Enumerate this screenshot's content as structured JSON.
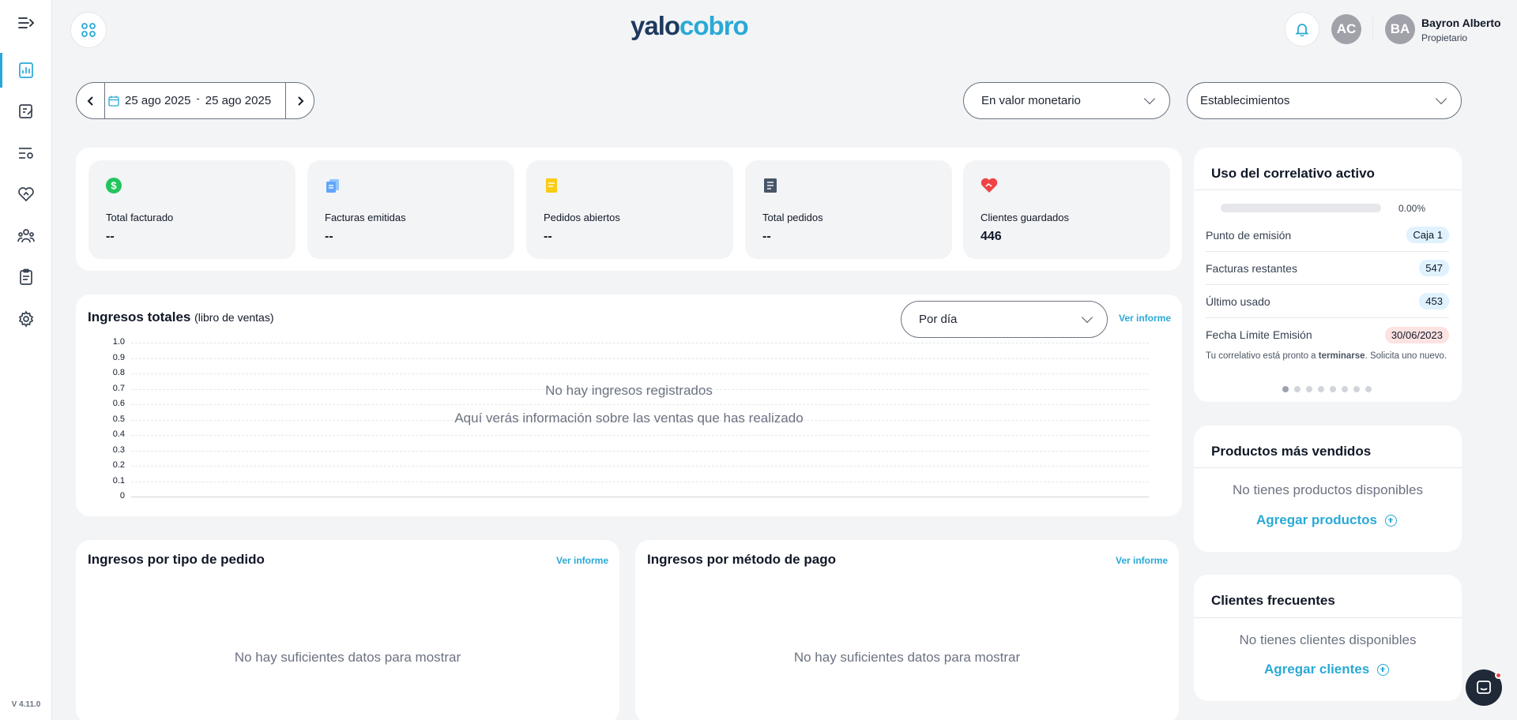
{
  "app": {
    "logo_part1": "yalo",
    "logo_part2": "cobro",
    "version": "V 4.11.0"
  },
  "sidebar": {
    "items": [
      {
        "name": "dashboard",
        "active": true
      },
      {
        "name": "invoices"
      },
      {
        "name": "filters-settings"
      },
      {
        "name": "clients"
      },
      {
        "name": "team"
      },
      {
        "name": "orders"
      },
      {
        "name": "settings"
      }
    ]
  },
  "header": {
    "avatar_small": "AC",
    "user_avatar": "BA",
    "user_name": "Bayron Alberto",
    "user_role": "Propietario"
  },
  "filters": {
    "date_start": "25 ago 2025",
    "date_sep": "-",
    "date_end": "25 ago 2025",
    "value_mode": "En valor monetario",
    "establishments": "Establecimientos"
  },
  "kpis": [
    {
      "label": "Total facturado",
      "value": "--",
      "icon": "dollar-icon",
      "color": "#22c55e"
    },
    {
      "label": "Facturas emitidas",
      "value": "--",
      "icon": "documents-icon",
      "color": "#60a5fa"
    },
    {
      "label": "Pedidos abiertos",
      "value": "--",
      "icon": "note-icon",
      "color": "#facc15"
    },
    {
      "label": "Total pedidos",
      "value": "--",
      "icon": "list-doc-icon",
      "color": "#475569"
    },
    {
      "label": "Clientes guardados",
      "value": "446",
      "icon": "heart-handshake-icon",
      "color": "#ef4444"
    }
  ],
  "income": {
    "title": "Ingresos totales",
    "subtitle": "(libro de ventas)",
    "period": "Por día",
    "link": "Ver informe",
    "empty_title": "No hay ingresos registrados",
    "empty_sub": "Aquí verás información sobre las ventas que has realizado"
  },
  "chart_data": {
    "type": "line",
    "title": "",
    "xlabel": "",
    "ylabel": "",
    "ylim": [
      0,
      1.0
    ],
    "yticks": [
      "1.0",
      "0.9",
      "0.8",
      "0.7",
      "0.6",
      "0.5",
      "0.4",
      "0.3",
      "0.2",
      "0.1",
      "0"
    ],
    "series": [],
    "grid": true
  },
  "by_order_type": {
    "title": "Ingresos por tipo de pedido",
    "link": "Ver informe",
    "empty": "No hay suficientes datos para mostrar"
  },
  "by_payment": {
    "title": "Ingresos por método de pago",
    "link": "Ver informe",
    "empty": "No hay suficientes datos para mostrar"
  },
  "correlativo": {
    "title": "Uso del correlativo activo",
    "progress_pct": 0.0,
    "progress_label": "0.00%",
    "rows": [
      {
        "label": "Punto de emisión",
        "value": "Caja 1"
      },
      {
        "label": "Facturas restantes",
        "value": "547"
      },
      {
        "label": "Último usado",
        "value": "453"
      },
      {
        "label": "Fecha Límite Emisión",
        "value": "30/06/2023"
      }
    ],
    "note_pre": "Tu correlativo está pronto a ",
    "note_bold": "terminarse",
    "note_post": ". Solicita uno nuevo.",
    "dots": 8,
    "active_dot": 0
  },
  "top_products": {
    "title": "Productos más vendidos",
    "empty": "No tienes productos disponibles",
    "cta": "Agregar productos"
  },
  "frequent_clients": {
    "title": "Clientes frecuentes",
    "empty": "No tienes clientes disponibles",
    "cta": "Agregar clientes"
  }
}
